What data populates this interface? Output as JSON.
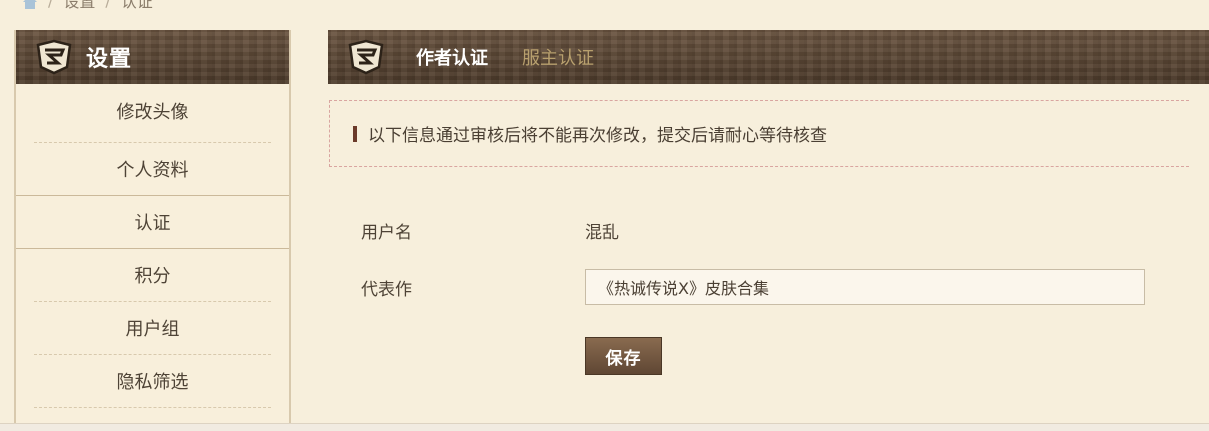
{
  "breadcrumb": {
    "home_icon": "home-icon",
    "separator": "/",
    "items": [
      "设置",
      "认证"
    ]
  },
  "sidebar": {
    "title": "设置",
    "emblem_icon": "shield-emblem-icon",
    "items": [
      {
        "label": "修改头像"
      },
      {
        "label": "个人资料"
      },
      {
        "label": "认证"
      },
      {
        "label": "积分"
      },
      {
        "label": "用户组"
      },
      {
        "label": "隐私筛选"
      }
    ]
  },
  "main": {
    "tabs": [
      {
        "label": "作者认证",
        "active": true
      },
      {
        "label": "服主认证",
        "active": false
      }
    ],
    "notice": "以下信息通过审核后将不能再次修改，提交后请耐心等待核查",
    "form": {
      "username_label": "用户名",
      "username_value": "混乱",
      "work_label": "代表作",
      "work_value": "《热诚传说X》皮肤合集"
    },
    "save_label": "保存"
  },
  "colors": {
    "background": "#f7efdc",
    "header_brown": "#5a4634",
    "accent_tab_inactive": "#b8a06e",
    "notice_border": "#d9a5a0"
  }
}
